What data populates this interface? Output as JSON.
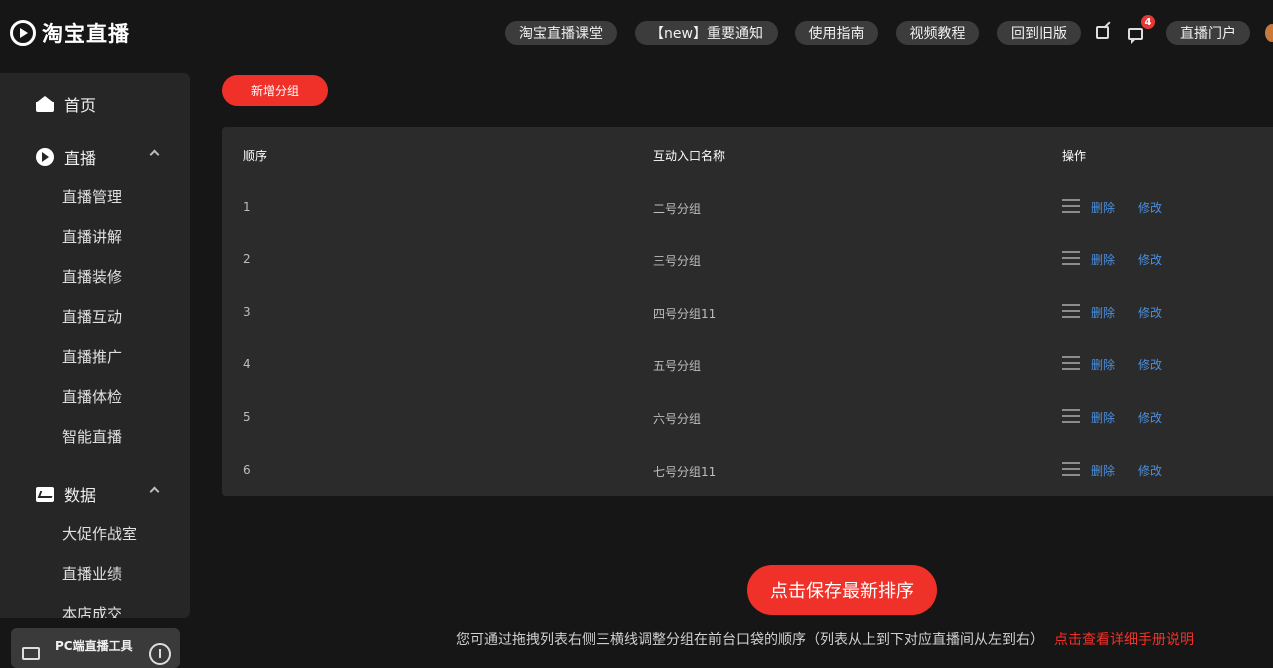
{
  "header": {
    "logo_text": "淘宝直播",
    "nav": [
      {
        "label": "淘宝直播课堂",
        "name": "nav-classroom"
      },
      {
        "label": "【new】重要通知",
        "name": "nav-notice"
      },
      {
        "label": "使用指南",
        "name": "nav-guide"
      },
      {
        "label": "视频教程",
        "name": "nav-video-tutorial"
      },
      {
        "label": "回到旧版",
        "name": "nav-old-version"
      },
      {
        "label": "直播门户",
        "name": "nav-portal"
      }
    ],
    "message_count": "4"
  },
  "sidebar": {
    "home": "首页",
    "live": {
      "label": "直播",
      "items": [
        "直播管理",
        "直播讲解",
        "直播装修",
        "直播互动",
        "直播推广",
        "直播体检",
        "智能直播"
      ]
    },
    "data": {
      "label": "数据",
      "items": [
        "大促作战室",
        "直播业绩",
        "本店成交"
      ]
    },
    "pc_tool_label": "PC端直播工具"
  },
  "main": {
    "add_group_label": "新增分组",
    "table": {
      "headers": [
        "顺序",
        "互动入口名称",
        "操作"
      ],
      "rows": [
        {
          "order": "1",
          "name": "二号分组"
        },
        {
          "order": "2",
          "name": "三号分组"
        },
        {
          "order": "3",
          "name": "四号分组11"
        },
        {
          "order": "4",
          "name": "五号分组"
        },
        {
          "order": "5",
          "name": "六号分组"
        },
        {
          "order": "6",
          "name": "七号分组11"
        }
      ],
      "delete_label": "删除",
      "edit_label": "修改"
    },
    "save_label": "点击保存最新排序",
    "hint_text": "您可通过拖拽列表右侧三横线调整分组在前台口袋的顺序（列表从上到下对应直播间从左到右）",
    "hint_link": "点击查看详细手册说明"
  },
  "colors": {
    "accent": "#f0312a",
    "link": "#4a90e2",
    "background": "#161616",
    "panel": "#2b2b2b"
  }
}
